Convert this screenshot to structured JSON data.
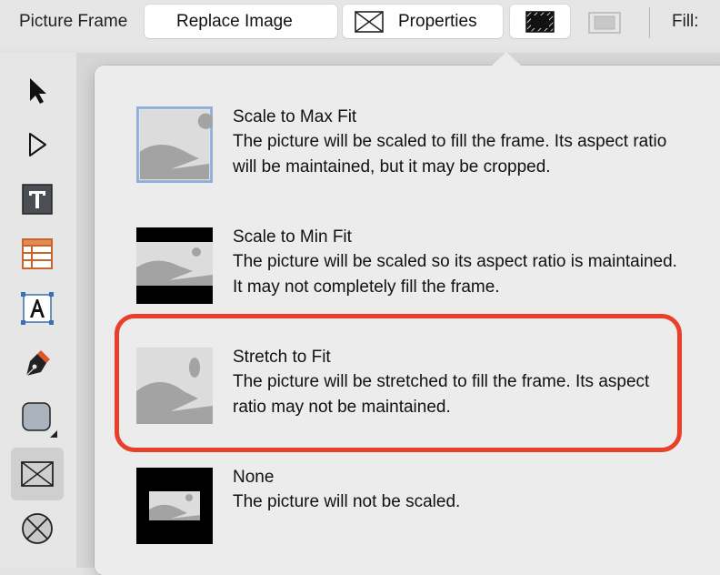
{
  "toolbar": {
    "title": "Picture Frame",
    "replace_image_label": "Replace Image",
    "properties_label": "Properties",
    "fill_label": "Fill:"
  },
  "left_tools": [
    {
      "icon": "arrow-pointer-icon",
      "selected": false
    },
    {
      "icon": "direct-select-icon",
      "selected": false
    },
    {
      "icon": "text-tool-icon",
      "selected": false
    },
    {
      "icon": "table-tool-icon",
      "selected": false
    },
    {
      "icon": "text-frame-icon",
      "selected": false
    },
    {
      "icon": "pen-tool-icon",
      "selected": false
    },
    {
      "icon": "shape-tool-icon",
      "selected": false
    },
    {
      "icon": "picture-frame-icon",
      "selected": true
    },
    {
      "icon": "vector-crop-icon",
      "selected": false
    }
  ],
  "popover": {
    "options": [
      {
        "title": "Scale to Max Fit",
        "desc": "The picture will be scaled to fill the frame. Its aspect ratio will be maintained, but it may be cropped.",
        "selected": true
      },
      {
        "title": "Scale to Min Fit",
        "desc": "The picture will be scaled so its aspect ratio is maintained. It may not completely fill the frame.",
        "selected": false
      },
      {
        "title": "Stretch to Fit",
        "desc": "The picture will be stretched to fill the frame. Its aspect ratio may not be maintained.",
        "selected": false,
        "highlighted": true
      },
      {
        "title": "None",
        "desc": "The picture will not be scaled.",
        "selected": false
      }
    ]
  },
  "colors": {
    "highlight": "#e8402a",
    "selection_border": "#8eaedc"
  }
}
